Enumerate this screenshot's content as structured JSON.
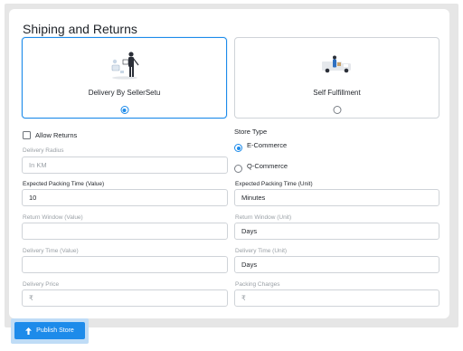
{
  "section": {
    "title": "Shiping and Returns"
  },
  "fulfillment": {
    "options": [
      {
        "label": "Delivery By SellerSetu",
        "selected": true,
        "icon": "delivery-person-icon"
      },
      {
        "label": "Self Fulfillment",
        "selected": false,
        "icon": "delivery-truck-icon"
      }
    ]
  },
  "allow_returns": {
    "label": "Allow Returns",
    "checked": false
  },
  "store_type": {
    "label": "Store Type",
    "options": [
      {
        "label": "E-Commerce",
        "selected": true
      },
      {
        "label": "Q-Commerce",
        "selected": false
      }
    ]
  },
  "fields": {
    "delivery_radius": {
      "label": "Delivery Radius",
      "placeholder": "In KM",
      "value": ""
    },
    "packing_time_value": {
      "label": "Expected Packing Time (Value)",
      "value": "10"
    },
    "packing_time_unit": {
      "label": "Expected Packing Time (Unit)",
      "value": "Minutes"
    },
    "return_window_value": {
      "label": "Return Window (Value)",
      "value": ""
    },
    "return_window_unit": {
      "label": "Return Window (Unit)",
      "value": "Days"
    },
    "delivery_time_value": {
      "label": "Delivery Time (Value)",
      "value": ""
    },
    "delivery_time_unit": {
      "label": "Delivery Time (Unit)",
      "value": "Days"
    },
    "delivery_price": {
      "label": "Delivery Price",
      "placeholder": "₹",
      "value": ""
    },
    "packing_charges": {
      "label": "Packing Charges",
      "placeholder": "₹",
      "value": ""
    }
  },
  "actions": {
    "publish_label": "Publish Store",
    "publish_icon": "arrow-up-icon"
  },
  "colors": {
    "accent": "#1d8bea",
    "background": "#e6e6e6",
    "border": "#cfd3d8"
  }
}
